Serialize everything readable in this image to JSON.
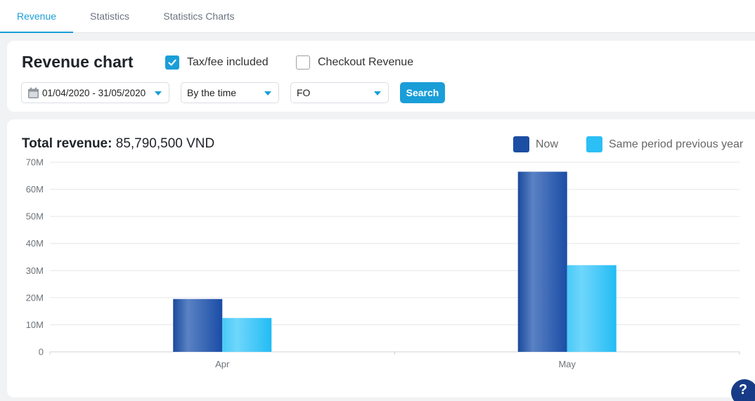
{
  "tabs": [
    {
      "label": "Revenue",
      "active": true
    },
    {
      "label": "Statistics",
      "active": false
    },
    {
      "label": "Statistics Charts",
      "active": false
    }
  ],
  "filters": {
    "title": "Revenue chart",
    "tax_checkbox": {
      "label": "Tax/fee included",
      "checked": true
    },
    "checkout_checkbox": {
      "label": "Checkout Revenue",
      "checked": false
    },
    "date_range": "01/04/2020 - 31/05/2020",
    "group_by": "By the time",
    "outlet": "FO",
    "search_label": "Search"
  },
  "summary": {
    "total_label": "Total revenue:",
    "total_value": "85,790,500 VND"
  },
  "legend": [
    {
      "label": "Now",
      "color": "#1c4ea3"
    },
    {
      "label": "Same period previous year",
      "color": "#2bbff5"
    }
  ],
  "help_label": "?",
  "colors": {
    "accent": "#1a9ed8",
    "now": "#1c4ea3",
    "previous": "#2bbff5"
  },
  "chart_data": {
    "type": "bar",
    "categories": [
      "Apr",
      "May"
    ],
    "series": [
      {
        "name": "Now",
        "values": [
          19500000,
          66500000
        ]
      },
      {
        "name": "Same period previous year",
        "values": [
          12500000,
          32000000
        ]
      }
    ],
    "ylim": [
      0,
      70000000
    ],
    "yticks": [
      "0",
      "10M",
      "20M",
      "30M",
      "40M",
      "50M",
      "60M",
      "70M"
    ],
    "grid": true,
    "legend_position": "top-right"
  }
}
